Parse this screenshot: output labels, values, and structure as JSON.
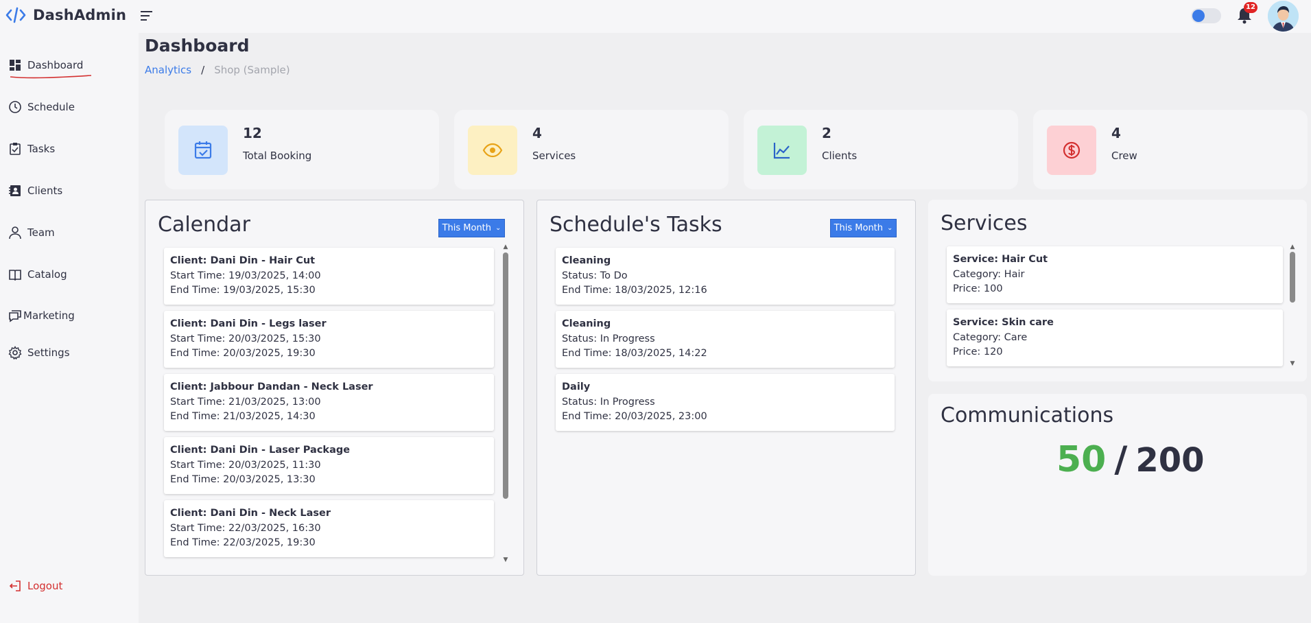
{
  "app": {
    "name": "DashAdmin"
  },
  "notifications": {
    "count": "12"
  },
  "colors": {
    "accent": "#3b7be8",
    "danger": "#d32f2f",
    "success": "#4caf50"
  },
  "sidebar": {
    "items": [
      {
        "label": "Dashboard",
        "icon": "dashboard-icon",
        "active": true
      },
      {
        "label": "Schedule",
        "icon": "clock-icon"
      },
      {
        "label": "Tasks",
        "icon": "clipboard-check-icon"
      },
      {
        "label": "Clients",
        "icon": "contact-card-icon"
      },
      {
        "label": "Team",
        "icon": "person-icon"
      },
      {
        "label": "Catalog",
        "icon": "book-icon"
      },
      {
        "label": "Marketing",
        "icon": "chat-icon"
      },
      {
        "label": "Settings",
        "icon": "gear-icon"
      }
    ],
    "logout": "Logout"
  },
  "header": {
    "title": "Dashboard",
    "breadcrumb": {
      "link": "Analytics",
      "separator": "/",
      "current": "Shop (Sample)"
    }
  },
  "stats": [
    {
      "value": "12",
      "label": "Total Booking",
      "icon": "calendar-check-icon"
    },
    {
      "value": "4",
      "label": "Services",
      "icon": "eye-icon"
    },
    {
      "value": "2",
      "label": "Clients",
      "icon": "chart-line-icon"
    },
    {
      "value": "4",
      "label": "Crew",
      "icon": "dollar-circle-icon"
    }
  ],
  "calendar": {
    "title": "Calendar",
    "period": "This Month",
    "items": [
      {
        "title": "Client: Dani Din - Hair Cut",
        "start": "Start Time: 19/03/2025, 14:00",
        "end": "End Time: 19/03/2025, 15:30"
      },
      {
        "title": "Client: Dani Din - Legs laser",
        "start": "Start Time: 20/03/2025, 15:30",
        "end": "End Time: 20/03/2025, 19:30"
      },
      {
        "title": "Client: Jabbour Dandan - Neck Laser",
        "start": "Start Time: 21/03/2025, 13:00",
        "end": "End Time: 21/03/2025, 14:30"
      },
      {
        "title": "Client: Dani Din - Laser Package",
        "start": "Start Time: 20/03/2025, 11:30",
        "end": "End Time: 20/03/2025, 13:30"
      },
      {
        "title": "Client: Dani Din - Neck Laser",
        "start": "Start Time: 22/03/2025, 16:30",
        "end": "End Time: 22/03/2025, 19:30"
      }
    ]
  },
  "tasks": {
    "title": "Schedule's Tasks",
    "period": "This Month",
    "items": [
      {
        "title": "Cleaning",
        "status": "Status: To Do",
        "end": "End Time: 18/03/2025, 12:16"
      },
      {
        "title": "Cleaning",
        "status": "Status: In Progress",
        "end": "End Time: 18/03/2025, 14:22"
      },
      {
        "title": "Daily",
        "status": "Status: In Progress",
        "end": "End Time: 20/03/2025, 23:00"
      }
    ]
  },
  "services": {
    "title": "Services",
    "items": [
      {
        "title": "Service: Hair Cut",
        "category": "Category: Hair",
        "price": "Price: 100"
      },
      {
        "title": "Service: Skin care",
        "category": "Category: Care",
        "price": "Price: 120"
      }
    ]
  },
  "communications": {
    "title": "Communications",
    "used": "50",
    "separator": "/",
    "total": "200"
  }
}
